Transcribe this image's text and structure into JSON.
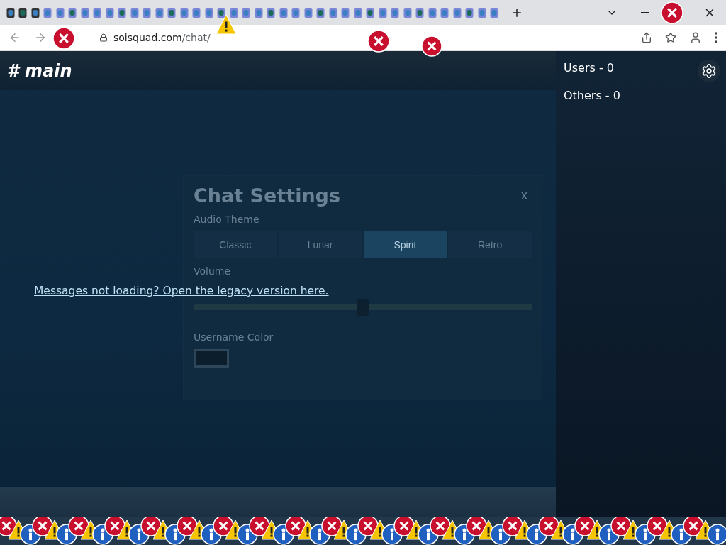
{
  "browser": {
    "address_host": "soisquad.com",
    "address_path": "/chat/"
  },
  "chat": {
    "channel": "# main",
    "notice_link": "Messages not loading? Open the legacy version here."
  },
  "settings_dialog": {
    "title": "Chat Settings",
    "close": "x",
    "audio_label": "Audio Theme",
    "audio_themes": [
      {
        "label": "Classic",
        "selected": false
      },
      {
        "label": "Lunar",
        "selected": false
      },
      {
        "label": "Spirit",
        "selected": true
      },
      {
        "label": "Retro",
        "selected": false
      }
    ],
    "volume_label": "Volume",
    "volume": {
      "level": 0.5
    },
    "color_label": "Username Color"
  },
  "sidebar": {
    "groups": [
      "Users - 0",
      "Others - 0"
    ]
  }
}
